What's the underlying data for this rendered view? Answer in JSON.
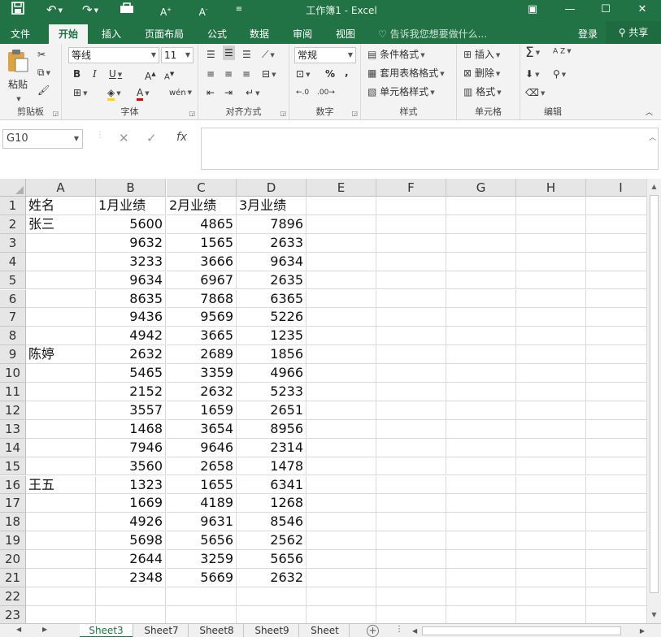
{
  "title": "工作簿1 - Excel",
  "quick_access": [
    "save-icon",
    "undo-icon",
    "redo-icon",
    "customize-icon",
    "font-increase-icon",
    "font-decrease-icon",
    "more-icon"
  ],
  "tabs": [
    "文件",
    "开始",
    "插入",
    "页面布局",
    "公式",
    "数据",
    "审阅",
    "视图"
  ],
  "active_tab": "开始",
  "tell_me": "告诉我您想要做什么...",
  "login": "登录",
  "share": "共享",
  "ribbon": {
    "clipboard": {
      "label": "剪贴板",
      "paste": "粘贴"
    },
    "font": {
      "label": "字体",
      "name": "等线",
      "size": "11",
      "bold": "B",
      "italic": "I",
      "underline": "U",
      "grow": "A",
      "shrink": "A",
      "font_color": "A",
      "phonetic": "wén"
    },
    "alignment": {
      "label": "对齐方式"
    },
    "number": {
      "label": "数字",
      "format": "常规",
      "percent": "%",
      "comma": ","
    },
    "styles": {
      "label": "样式",
      "conditional": "条件格式",
      "table": "套用表格格式",
      "cell": "单元格样式"
    },
    "cells": {
      "label": "单元格",
      "insert": "插入",
      "delete": "删除",
      "format": "格式"
    },
    "editing": {
      "label": "编辑",
      "sort": "A Z"
    }
  },
  "name_box": "G10",
  "formula_icons": {
    "cancel": "✕",
    "enter": "✓",
    "fx": "fx"
  },
  "columns": [
    "A",
    "B",
    "C",
    "D",
    "E",
    "F",
    "G",
    "H",
    "I"
  ],
  "rows": [
    [
      "姓名",
      "1月业绩",
      "2月业绩",
      "3月业绩"
    ],
    [
      "张三",
      "5600",
      "4865",
      "7896"
    ],
    [
      "",
      "9632",
      "1565",
      "2633"
    ],
    [
      "",
      "3233",
      "3666",
      "9634"
    ],
    [
      "",
      "9634",
      "6967",
      "2635"
    ],
    [
      "",
      "8635",
      "7868",
      "6365"
    ],
    [
      "",
      "9436",
      "9569",
      "5226"
    ],
    [
      "",
      "4942",
      "3665",
      "1235"
    ],
    [
      "陈婷",
      "2632",
      "2689",
      "1856"
    ],
    [
      "",
      "5465",
      "3359",
      "4966"
    ],
    [
      "",
      "2152",
      "2632",
      "5233"
    ],
    [
      "",
      "3557",
      "1659",
      "2651"
    ],
    [
      "",
      "1468",
      "3654",
      "8956"
    ],
    [
      "",
      "7946",
      "9646",
      "2314"
    ],
    [
      "",
      "3560",
      "2658",
      "1478"
    ],
    [
      "王五",
      "1323",
      "1655",
      "6341"
    ],
    [
      "",
      "1669",
      "4189",
      "1268"
    ],
    [
      "",
      "4926",
      "9631",
      "8546"
    ],
    [
      "",
      "5698",
      "5656",
      "2562"
    ],
    [
      "",
      "2644",
      "3259",
      "5656"
    ],
    [
      "",
      "2348",
      "5669",
      "2632"
    ],
    [
      "",
      "",
      "",
      ""
    ],
    [
      "",
      "",
      "",
      ""
    ]
  ],
  "sheets": [
    "Sheet3",
    "Sheet7",
    "Sheet8",
    "Sheet9",
    "Sheet"
  ],
  "active_sheet": "Sheet3",
  "colors": {
    "accent": "#217346",
    "header_bg": "#e6e6e6",
    "grid_line": "#dadada"
  }
}
